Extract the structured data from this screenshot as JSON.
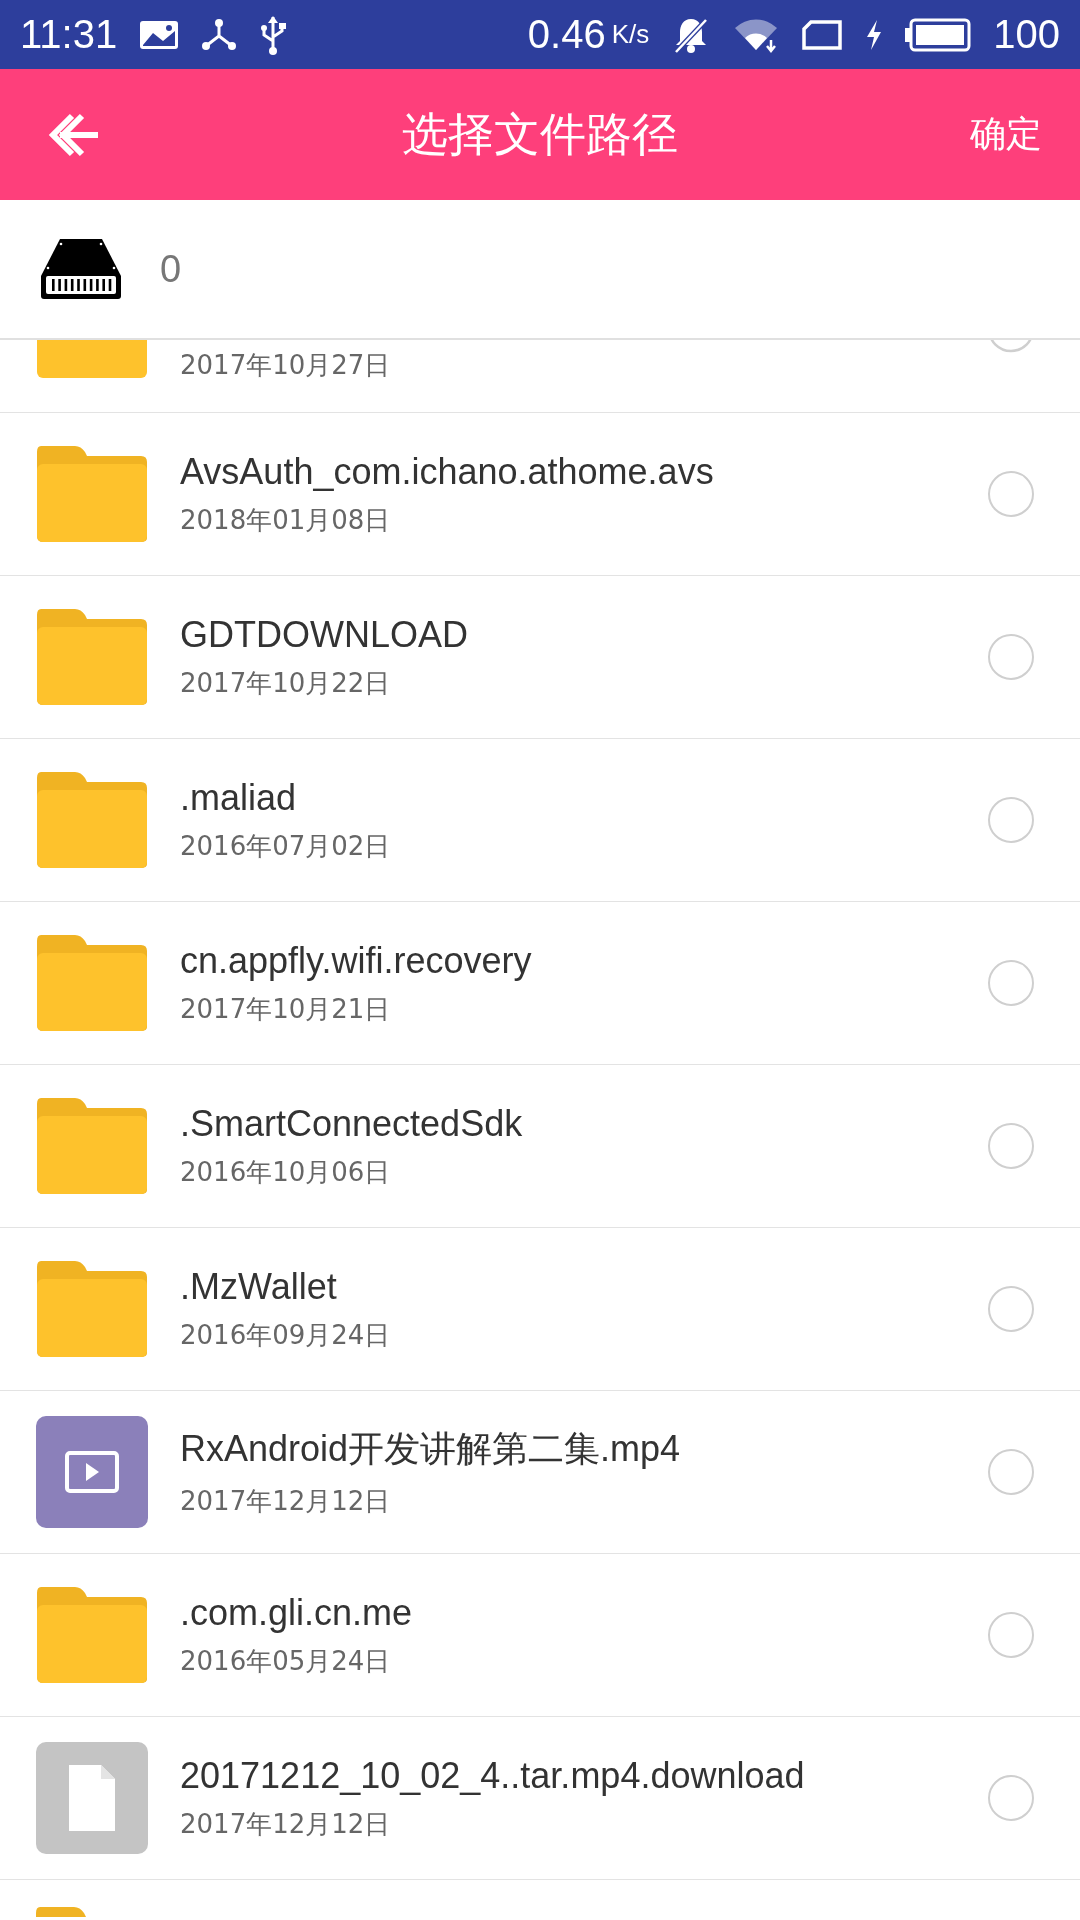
{
  "status_bar": {
    "time": "11:31",
    "speed": "0.46",
    "speed_unit": "K/s",
    "battery": "100"
  },
  "header": {
    "title": "选择文件路径",
    "confirm": "确定"
  },
  "storage": {
    "label": "0"
  },
  "files": [
    {
      "kind": "folder",
      "date": "2017年10月27日",
      "selected": false
    },
    {
      "kind": "folder",
      "name": "AvsAuth_com.ichano.athome.avs",
      "date": "2018年01月08日",
      "selected": false
    },
    {
      "kind": "folder",
      "name": "GDTDOWNLOAD",
      "date": "2017年10月22日",
      "selected": false
    },
    {
      "kind": "folder",
      "name": ".maliad",
      "date": "2016年07月02日",
      "selected": false
    },
    {
      "kind": "folder",
      "name": "cn.appfly.wifi.recovery",
      "date": "2017年10月21日",
      "selected": false
    },
    {
      "kind": "folder",
      "name": ".SmartConnectedSdk",
      "date": "2016年10月06日",
      "selected": false
    },
    {
      "kind": "folder",
      "name": ".MzWallet",
      "date": "2016年09月24日",
      "selected": false
    },
    {
      "kind": "video",
      "name": "RxAndroid开发讲解第二集.mp4",
      "date": "2017年12月12日",
      "selected": false
    },
    {
      "kind": "folder",
      "name": ".com.gli.cn.me",
      "date": "2016年05月24日",
      "selected": false
    },
    {
      "kind": "file",
      "name": "20171212_10_02_4..tar.mp4.download",
      "date": "2017年12月12日",
      "selected": false
    },
    {
      "kind": "folder"
    }
  ]
}
